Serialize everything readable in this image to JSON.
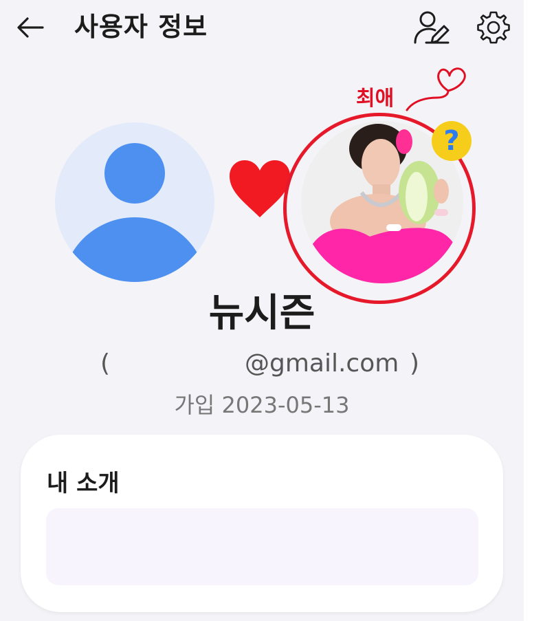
{
  "header": {
    "title": "사용자 정보"
  },
  "favorite": {
    "label": "최애"
  },
  "profile": {
    "nickname": "뉴시즌",
    "email_open": "(",
    "email_domain": "@gmail.com",
    "email_close": ")",
    "joined": "가입 2023-05-13"
  },
  "intro": {
    "title": "내 소개",
    "text": ""
  },
  "colors": {
    "background": "#f4f4f8",
    "accent_blue": "#4d90f0",
    "heart_red": "#e6192b",
    "badge_yellow": "#f7cd1b"
  },
  "icons": [
    "back-arrow-icon",
    "edit-profile-icon",
    "gear-icon",
    "heart-icon",
    "question-icon"
  ]
}
